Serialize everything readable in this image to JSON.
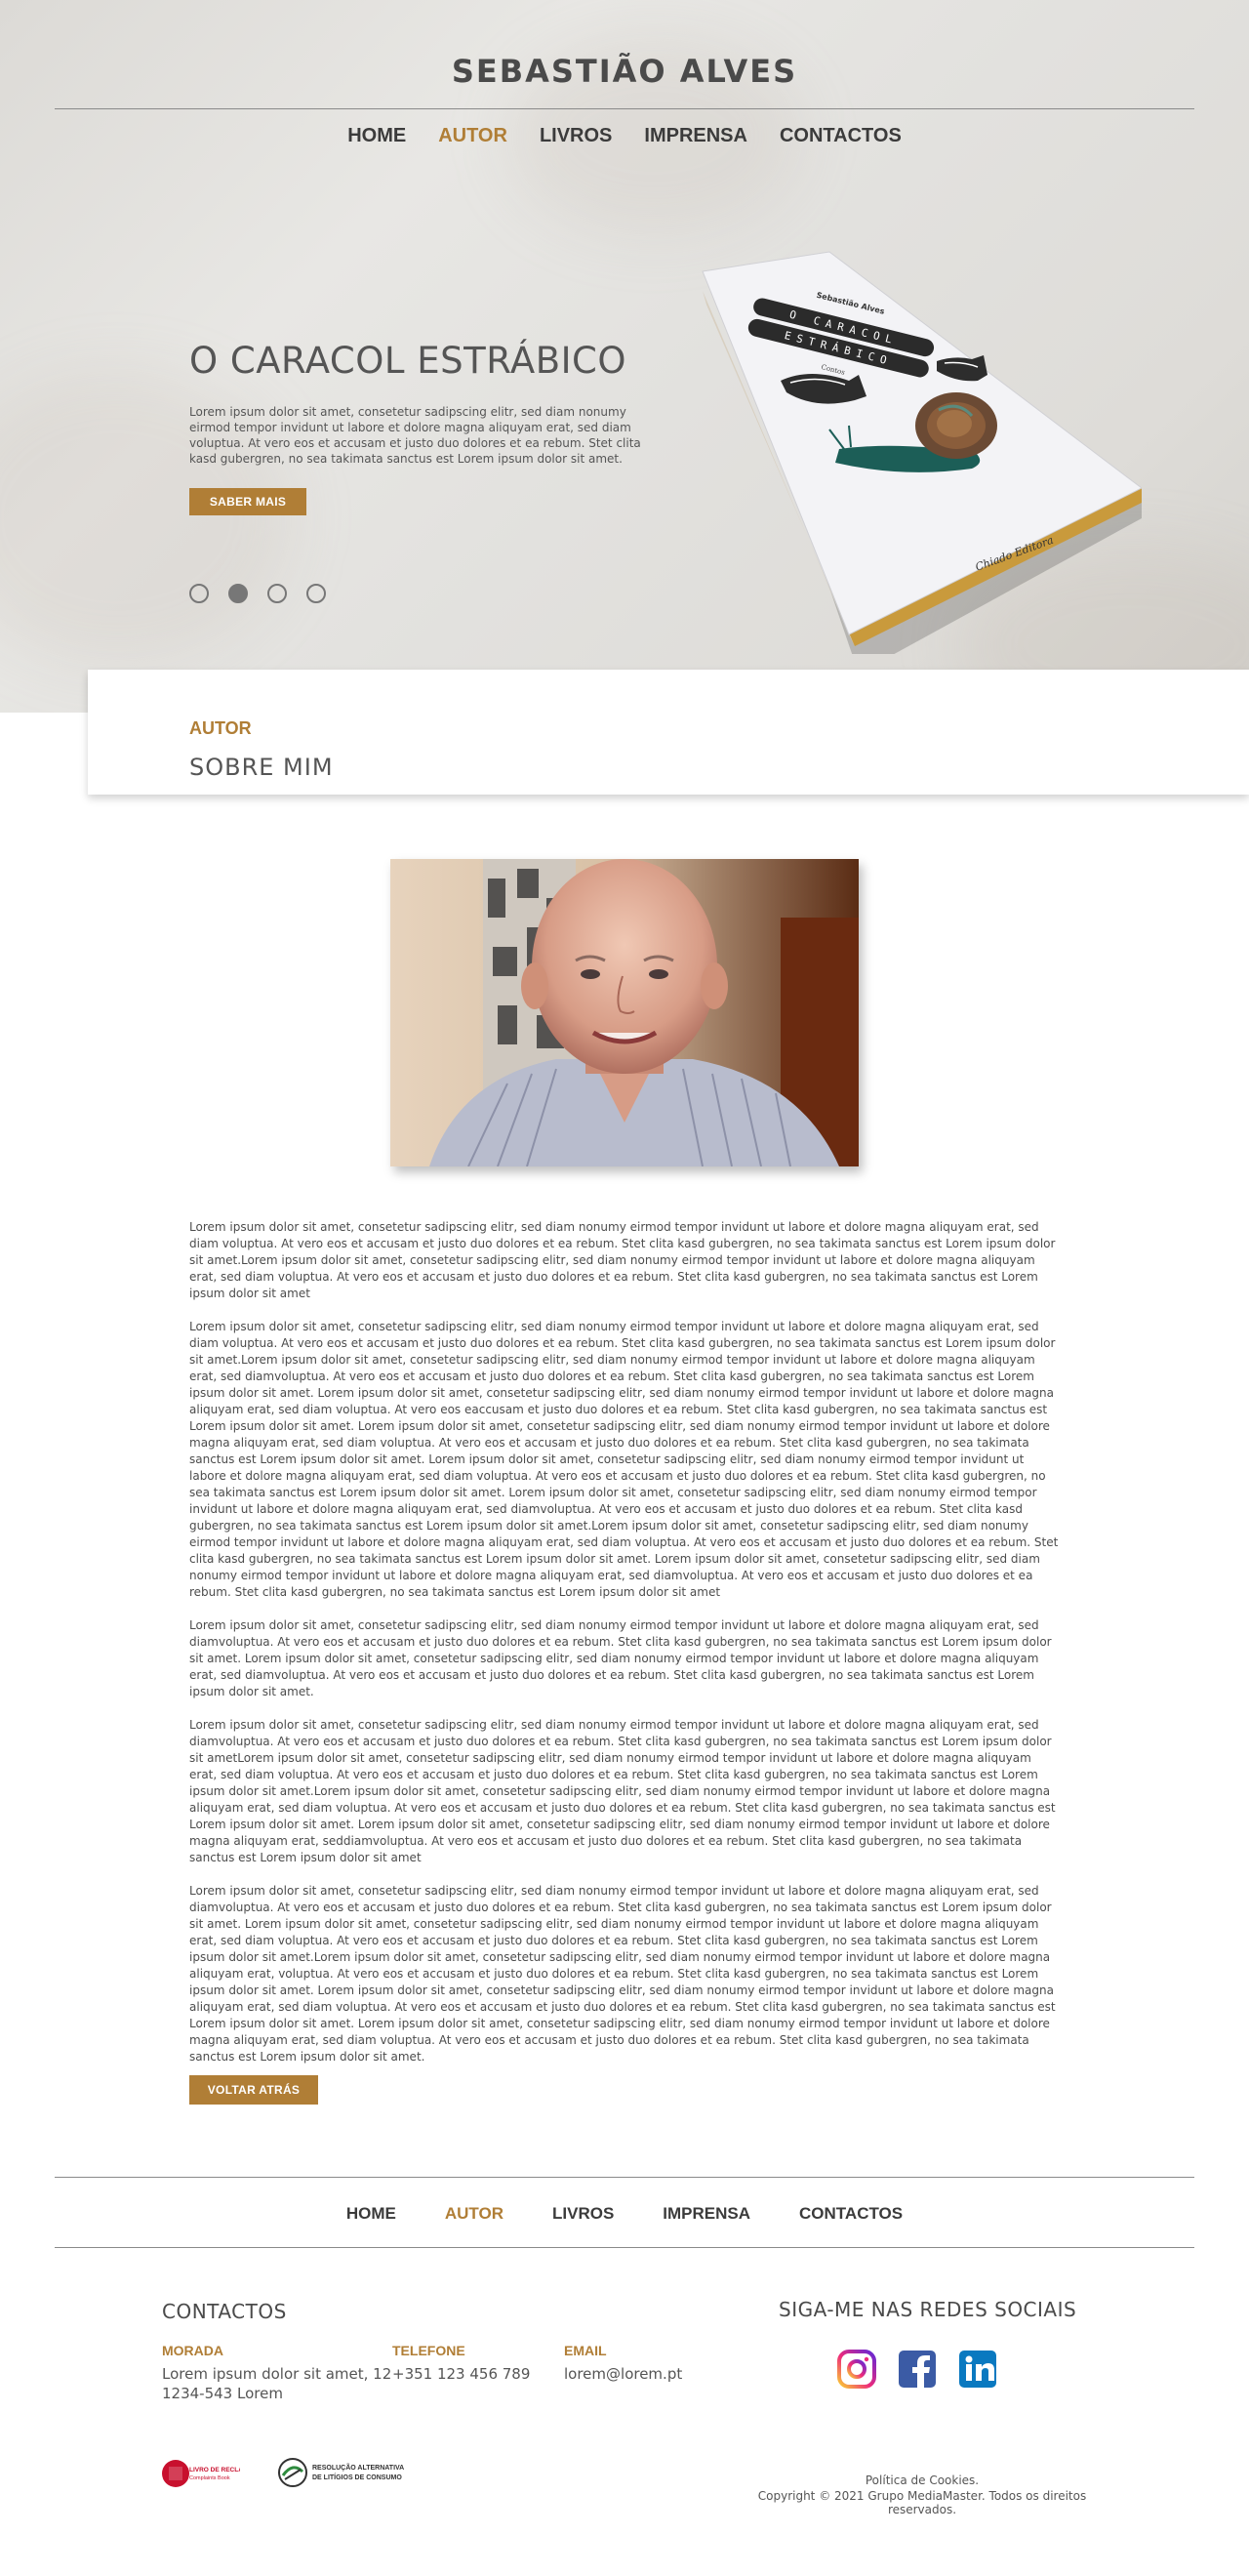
{
  "site": {
    "title": "SEBASTIÃO ALVES"
  },
  "nav": {
    "items": [
      "HOME",
      "AUTOR",
      "LIVROS",
      "IMPRENSA",
      "CONTACTOS"
    ],
    "active": "AUTOR"
  },
  "hero": {
    "title": "O CARACOL ESTRÁBICO",
    "text": "Lorem ipsum dolor sit amet, consetetur sadipscing elitr, sed diam nonumy eirmod tempor invidunt ut labore et dolore magna aliquyam erat, sed diam voluptua. At vero eos et accusam et justo duo dolores et ea rebum. Stet clita kasd gubergren, no sea takimata sanctus est Lorem ipsum dolor sit amet.",
    "button": "SABER MAIS",
    "slides_count": 4,
    "active_slide": 2,
    "book": {
      "author": "Sebastião Alves",
      "title_line1": "O CARACOL",
      "title_line2": "ESTRÁBICO",
      "genre": "Contos",
      "publisher": "Chiado Editora"
    }
  },
  "author_section": {
    "eyebrow": "AUTOR",
    "title": "SOBRE MIM"
  },
  "bio": {
    "paragraphs": [
      "Lorem ipsum dolor sit amet, consetetur sadipscing elitr, sed diam nonumy eirmod tempor invidunt ut labore et dolore magna aliquyam erat, sed diam voluptua. At vero eos et accusam et justo duo dolores et ea rebum. Stet clita kasd gubergren, no sea takimata sanctus est Lorem ipsum dolor sit amet.Lorem ipsum dolor sit amet, consetetur sadipscing elitr, sed diam nonumy eirmod tempor invidunt ut labore et dolore magna aliquyam erat, sed diam voluptua. At vero eos et accusam et justo duo dolores et ea rebum. Stet clita kasd gubergren, no sea takimata sanctus est Lorem ipsum dolor sit amet",
      "Lorem ipsum dolor sit amet, consetetur sadipscing elitr, sed diam nonumy eirmod tempor invidunt ut labore et dolore magna aliquyam erat, sed diam voluptua. At vero eos et accusam et justo duo dolores et ea rebum. Stet clita kasd gubergren, no sea takimata sanctus est Lorem ipsum dolor sit amet.Lorem ipsum dolor sit amet, consetetur sadipscing elitr, sed diam nonumy eirmod tempor invidunt ut labore et dolore magna aliquyam erat, sed diamvoluptua. At vero eos et accusam et justo duo dolores et ea rebum. Stet clita kasd gubergren, no sea takimata sanctus est Lorem ipsum dolor sit amet. Lorem ipsum dolor sit amet, consetetur sadipscing elitr, sed diam nonumy eirmod tempor invidunt ut labore et dolore magna aliquyam erat, sed diam voluptua. At vero eos eaccusam et justo duo dolores et ea rebum. Stet clita kasd gubergren, no sea takimata sanctus est Lorem ipsum dolor sit amet. Lorem ipsum dolor sit amet, consetetur sadipscing elitr, sed diam nonumy eirmod tempor invidunt ut labore et dolore magna aliquyam erat, sed diam voluptua. At vero eos et accusam et justo duo dolores et ea rebum. Stet clita kasd gubergren, no sea takimata sanctus est Lorem ipsum dolor sit amet. Lorem ipsum dolor sit amet, consetetur sadipscing elitr, sed diam nonumy eirmod tempor invidunt ut labore et dolore magna aliquyam erat, sed diam voluptua. At vero eos et accusam et justo duo dolores et ea rebum. Stet clita kasd gubergren, no sea takimata sanctus est Lorem ipsum dolor sit amet. Lorem ipsum dolor sit amet, consetetur sadipscing elitr, sed diam nonumy eirmod tempor invidunt ut labore et dolore magna aliquyam erat, sed diamvoluptua. At vero eos et accusam et justo duo dolores et ea rebum. Stet clita kasd gubergren, no sea takimata sanctus est Lorem ipsum dolor sit amet.Lorem ipsum dolor sit amet, consetetur sadipscing elitr, sed diam nonumy eirmod tempor invidunt ut labore et dolore magna aliquyam erat, sed diam voluptua. At vero eos et accusam et justo duo dolores et ea rebum. Stet clita kasd gubergren, no sea takimata sanctus est Lorem ipsum dolor sit amet. Lorem ipsum dolor sit amet, consetetur sadipscing elitr, sed diam nonumy eirmod tempor invidunt ut labore et dolore magna aliquyam erat, sed diamvoluptua. At vero eos et accusam et justo duo dolores et ea rebum. Stet clita kasd gubergren, no sea takimata sanctus est Lorem ipsum dolor sit amet",
      "Lorem ipsum dolor sit amet, consetetur sadipscing elitr, sed diam nonumy eirmod tempor invidunt ut labore et dolore magna aliquyam erat, sed diamvoluptua. At vero eos et accusam et justo duo dolores et ea rebum. Stet clita kasd gubergren, no sea takimata sanctus est Lorem ipsum dolor sit amet. Lorem ipsum dolor sit amet, consetetur sadipscing elitr, sed diam nonumy eirmod tempor invidunt ut labore et dolore magna aliquyam erat, sed diamvoluptua. At vero eos et accusam et justo duo dolores et ea rebum. Stet clita kasd gubergren, no sea takimata sanctus est Lorem ipsum dolor sit amet.",
      "Lorem ipsum dolor sit amet, consetetur sadipscing elitr, sed diam nonumy eirmod tempor invidunt ut labore et dolore magna aliquyam erat, sed diamvoluptua. At vero eos et accusam et justo duo dolores et ea rebum. Stet clita kasd gubergren, no sea takimata sanctus est Lorem ipsum dolor sit ametLorem ipsum dolor sit amet, consetetur sadipscing elitr, sed diam nonumy eirmod tempor invidunt ut labore et dolore magna aliquyam erat, sed diam voluptua. At vero eos et accusam et justo duo dolores et ea rebum. Stet clita kasd gubergren, no sea takimata sanctus est Lorem ipsum dolor sit amet.Lorem ipsum dolor sit amet, consetetur sadipscing elitr, sed diam nonumy eirmod tempor invidunt ut labore et dolore magna aliquyam erat, sed diam voluptua. At vero eos et accusam et justo duo dolores et ea rebum. Stet clita kasd gubergren, no sea takimata sanctus est Lorem ipsum dolor sit amet. Lorem ipsum dolor sit amet, consetetur sadipscing elitr, sed diam nonumy eirmod tempor invidunt ut labore et dolore magna aliquyam erat, seddiamvoluptua. At vero eos et accusam et justo duo dolores et ea rebum. Stet clita kasd gubergren, no sea takimata sanctus est Lorem ipsum dolor sit amet",
      "Lorem ipsum dolor sit amet, consetetur sadipscing elitr, sed diam nonumy eirmod tempor invidunt ut labore et dolore magna aliquyam erat, sed diamvoluptua. At vero eos et accusam et justo duo dolores et ea rebum. Stet clita kasd gubergren, no sea takimata sanctus est Lorem ipsum dolor sit amet. Lorem ipsum dolor sit amet, consetetur sadipscing elitr, sed diam nonumy eirmod tempor invidunt ut labore et dolore magna aliquyam erat, sed diam voluptua. At vero eos et accusam et justo duo dolores et ea rebum. Stet clita kasd gubergren, no sea takimata sanctus est Lorem ipsum dolor sit amet.Lorem ipsum dolor sit amet, consetetur sadipscing elitr, sed diam nonumy eirmod tempor invidunt ut labore et dolore magna aliquyam erat,  voluptua. At vero eos et accusam et justo duo dolores et ea rebum. Stet clita kasd gubergren, no sea takimata sanctus est Lorem ipsum dolor sit amet. Lorem ipsum dolor sit amet, consetetur sadipscing elitr, sed diam nonumy eirmod tempor invidunt ut labore et dolore magna aliquyam erat, sed diam voluptua. At vero eos et accusam et justo duo dolores et ea rebum. Stet clita kasd gubergren, no sea takimata sanctus est Lorem ipsum dolor sit amet. Lorem ipsum dolor sit amet, consetetur sadipscing elitr, sed diam nonumy eirmod tempor invidunt ut labore et dolore magna aliquyam erat, sed diam voluptua. At vero eos et accusam et justo duo dolores et ea rebum. Stet clita kasd gubergren, no sea takimata sanctus est Lorem ipsum dolor sit amet."
    ]
  },
  "back_button": "VOLTAR ATRÁS",
  "footer": {
    "contacts_heading": "CONTACTOS",
    "morada_label": "MORADA",
    "morada_line1": "Lorem ipsum dolor sit amet, 12",
    "morada_line2": "1234-543 Lorem",
    "telefone_label": "TELEFONE",
    "telefone_value": "+351 123 456 789",
    "email_label": "EMAIL",
    "email_value": "lorem@lorem.pt",
    "social_heading": "SIGA-ME NAS REDES SOCIAIS",
    "social": [
      "instagram-icon",
      "facebook-icon",
      "linkedin-icon"
    ],
    "badge1_text": "LIVRO DE RECLAMAÇÕES",
    "badge1_sub": "Complaints Book",
    "badge2_line1": "RESOLUÇÃO ALTERNATIVA",
    "badge2_line2": "DE LITÍGIOS DE CONSUMO",
    "cookies": "Política de Cookies.",
    "copyright": "Copyright © 2021 Grupo MediaMaster. Todos os direitos reservados."
  },
  "colors": {
    "accent": "#b07e36",
    "text": "#555555",
    "heading": "#4a4a4a"
  }
}
